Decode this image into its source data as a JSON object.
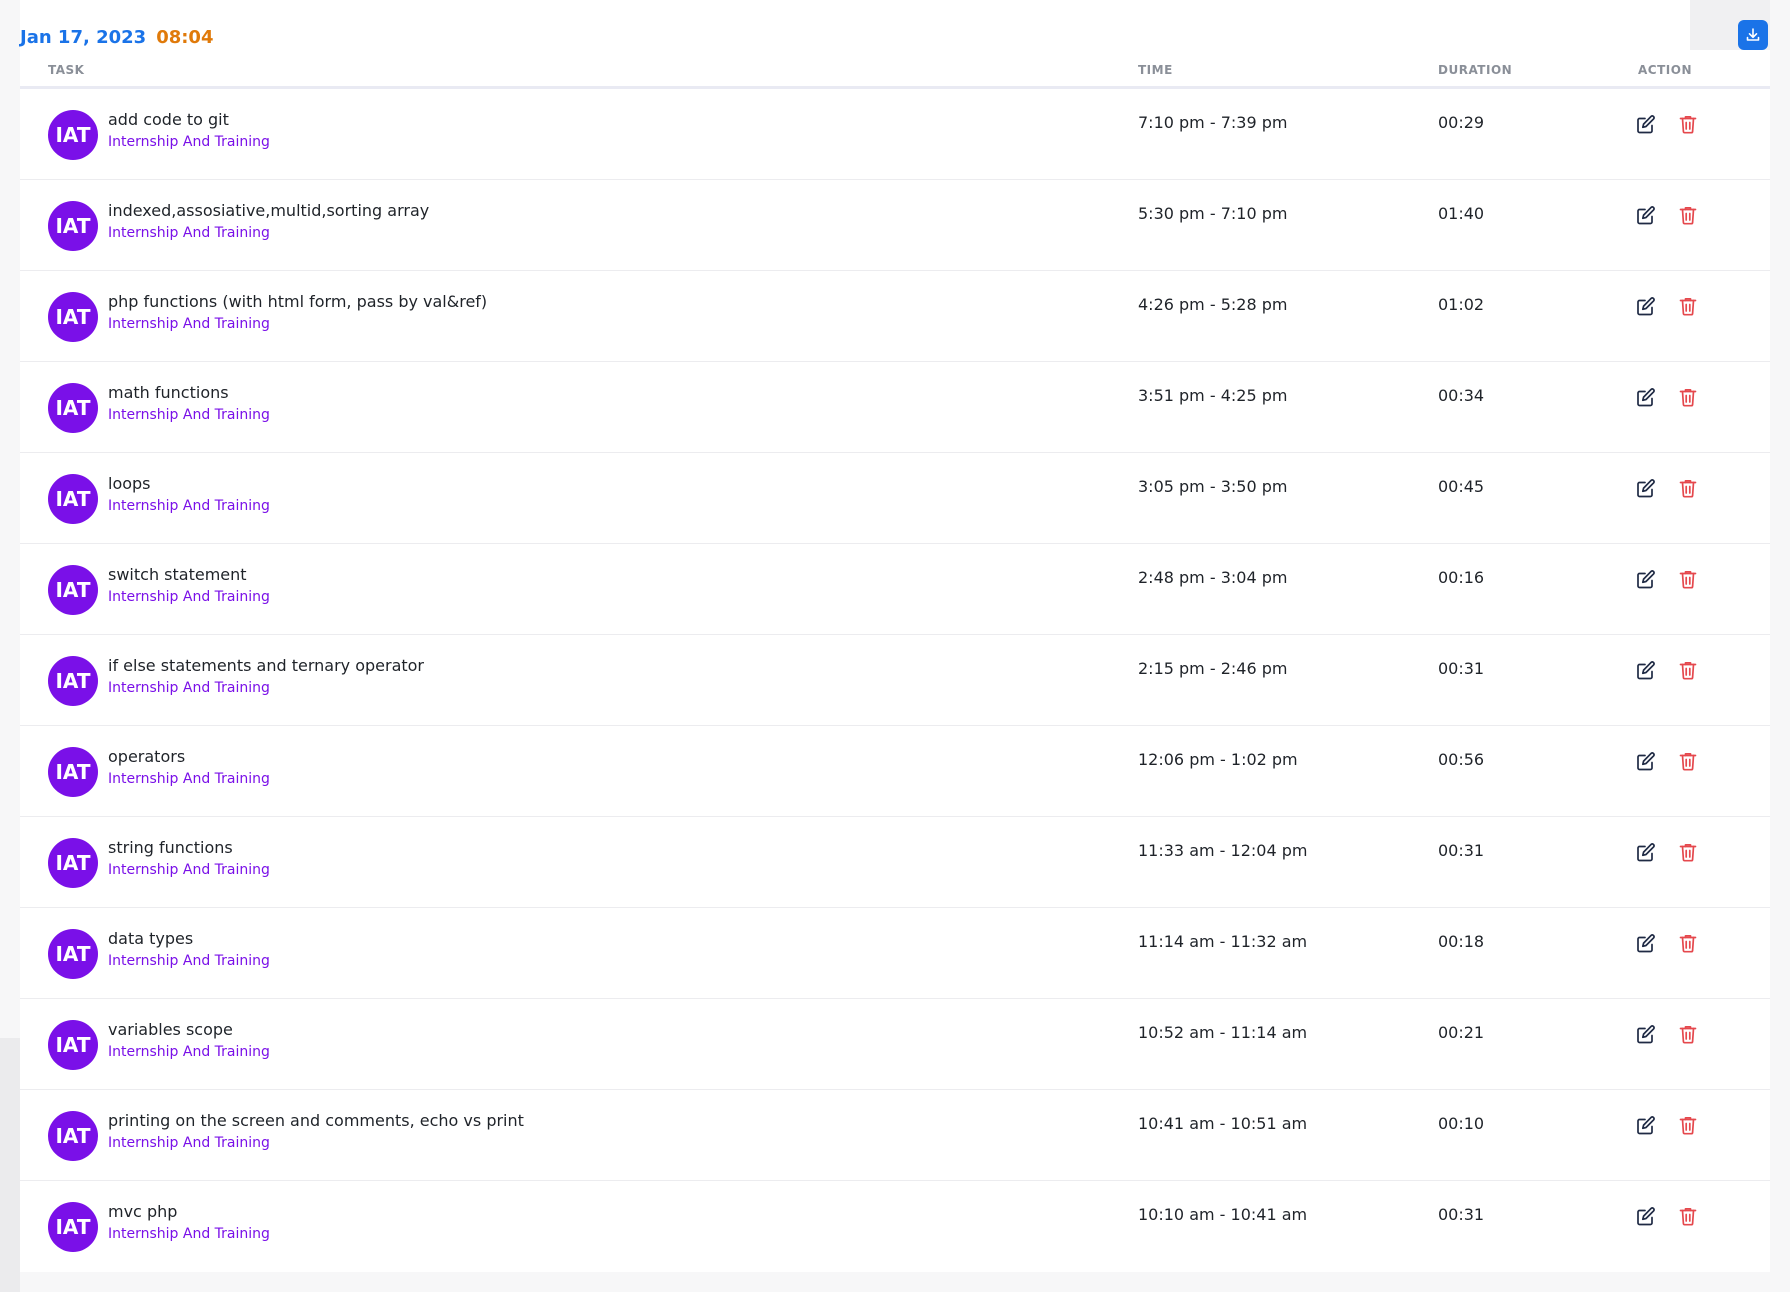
{
  "header": {
    "date": "Jan 17, 2023",
    "time": "08:04"
  },
  "columns": {
    "task": "TASK",
    "time": "TIME",
    "duration": "DURATION",
    "action": "ACTION"
  },
  "icons": {
    "download": "download-icon",
    "edit": "edit-icon",
    "delete": "trash-icon"
  },
  "colors": {
    "date": "#1a73e8",
    "time": "#e07a0a",
    "avatar": "#7a10e8",
    "project": "#7a10e8",
    "delete_icon": "#e5484d",
    "download_button": "#1a73e8"
  },
  "rows": [
    {
      "avatar": "IAT",
      "task": "add code to git",
      "project": "Internship And Training",
      "time": "7:10 pm - 7:39 pm",
      "duration": "00:29"
    },
    {
      "avatar": "IAT",
      "task": "indexed,assosiative,multid,sorting array",
      "project": "Internship And Training",
      "time": "5:30 pm - 7:10 pm",
      "duration": "01:40"
    },
    {
      "avatar": "IAT",
      "task": "php functions (with html form, pass by val&ref)",
      "project": "Internship And Training",
      "time": "4:26 pm - 5:28 pm",
      "duration": "01:02"
    },
    {
      "avatar": "IAT",
      "task": "math functions",
      "project": "Internship And Training",
      "time": "3:51 pm - 4:25 pm",
      "duration": "00:34"
    },
    {
      "avatar": "IAT",
      "task": "loops",
      "project": "Internship And Training",
      "time": "3:05 pm - 3:50 pm",
      "duration": "00:45"
    },
    {
      "avatar": "IAT",
      "task": "switch statement",
      "project": "Internship And Training",
      "time": "2:48 pm - 3:04 pm",
      "duration": "00:16"
    },
    {
      "avatar": "IAT",
      "task": "if else statements and ternary operator",
      "project": "Internship And Training",
      "time": "2:15 pm - 2:46 pm",
      "duration": "00:31"
    },
    {
      "avatar": "IAT",
      "task": "operators",
      "project": "Internship And Training",
      "time": "12:06 pm - 1:02 pm",
      "duration": "00:56"
    },
    {
      "avatar": "IAT",
      "task": "string functions",
      "project": "Internship And Training",
      "time": "11:33 am - 12:04 pm",
      "duration": "00:31"
    },
    {
      "avatar": "IAT",
      "task": "data types",
      "project": "Internship And Training",
      "time": "11:14 am - 11:32 am",
      "duration": "00:18"
    },
    {
      "avatar": "IAT",
      "task": "variables scope",
      "project": "Internship And Training",
      "time": "10:52 am - 11:14 am",
      "duration": "00:21"
    },
    {
      "avatar": "IAT",
      "task": "printing on the screen and comments, echo vs print",
      "project": "Internship And Training",
      "time": "10:41 am - 10:51 am",
      "duration": "00:10"
    },
    {
      "avatar": "IAT",
      "task": "mvc php",
      "project": "Internship And Training",
      "time": "10:10 am - 10:41 am",
      "duration": "00:31"
    }
  ]
}
